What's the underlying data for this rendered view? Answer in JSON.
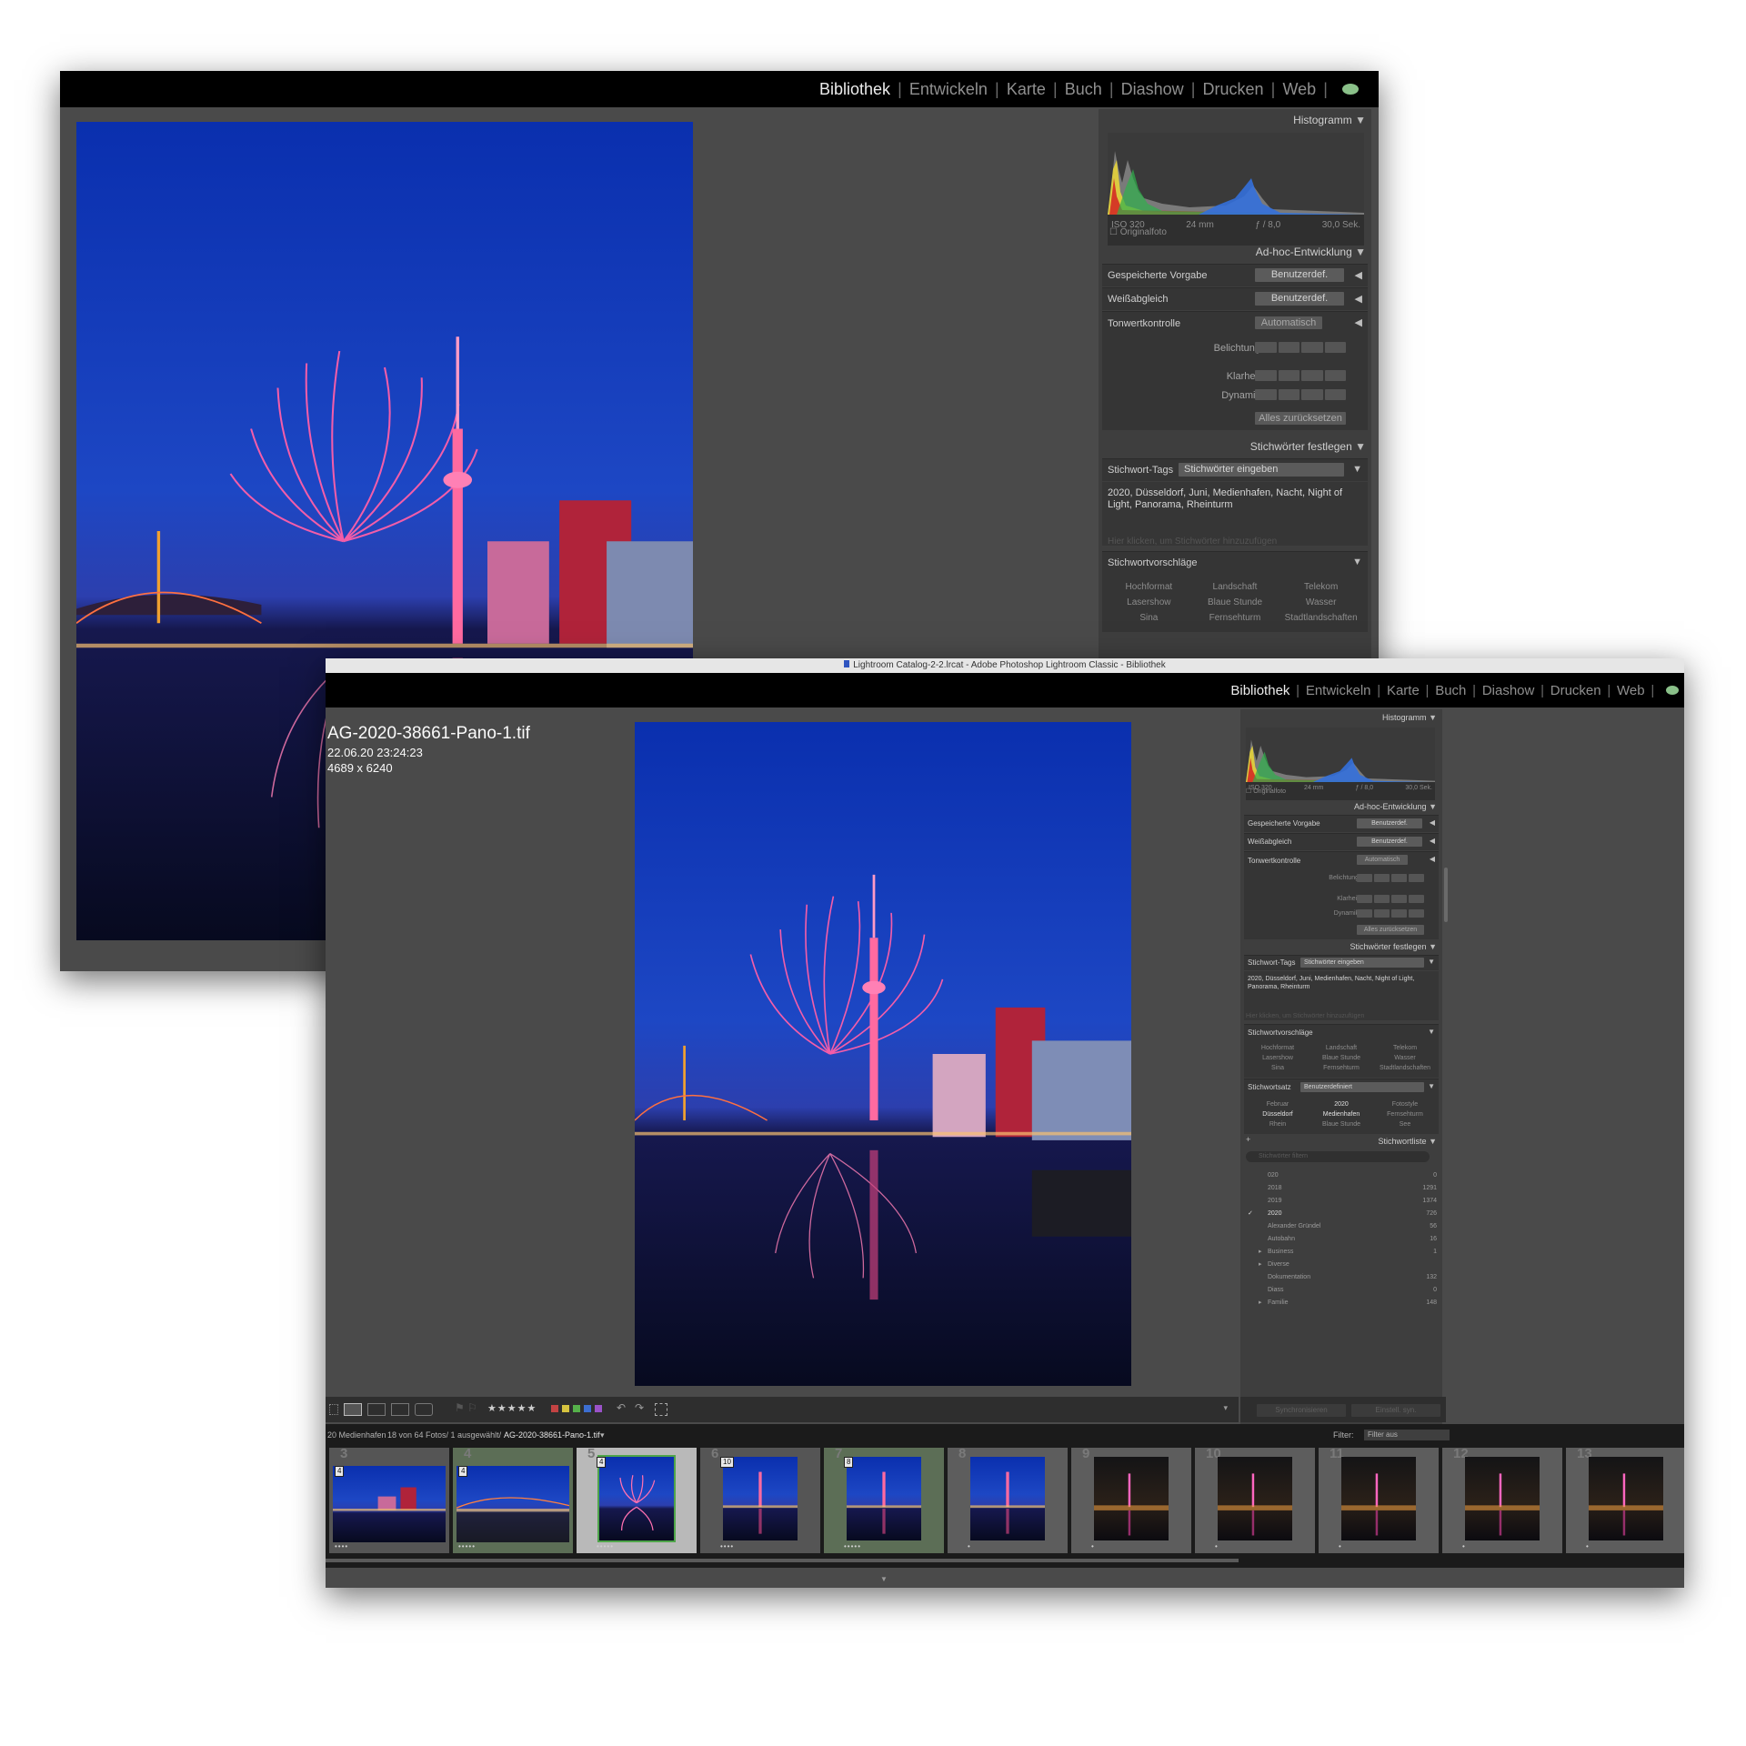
{
  "modules": [
    "Bibliothek",
    "Entwickeln",
    "Karte",
    "Buch",
    "Diashow",
    "Drucken",
    "Web"
  ],
  "active_module": "Bibliothek",
  "title_bar": "Lightroom Catalog-2-2.lrcat - Adobe Photoshop Lightroom Classic - Bibliothek",
  "info_overlay": {
    "filename": "AG-2020-38661-Pano-1.tif",
    "datetime": "22.06.20 23:24:23",
    "dimensions": "4689 x 6240"
  },
  "histogram": {
    "title": "Histogramm",
    "iso": "ISO 320",
    "focal": "24 mm",
    "aperture": "ƒ / 8,0",
    "shutter": "30,0 Sek.",
    "original": "Originalfoto"
  },
  "quick_develop": {
    "title": "Ad-hoc-Entwicklung",
    "saved_preset_label": "Gespeicherte Vorgabe",
    "saved_preset_value": "Benutzerdef.",
    "wb_label": "Weißabgleich",
    "wb_value": "Benutzerdef.",
    "tone_label": "Tonwertkontrolle",
    "tone_button": "Automatisch",
    "exposure_label": "Belichtung",
    "clarity_label": "Klarheit",
    "vibrance_label": "Dynamik",
    "reset_button": "Alles zurücksetzen"
  },
  "keywording": {
    "title": "Stichwörter festlegen",
    "tags_label": "Stichwort-Tags",
    "tags_dropdown": "Stichwörter eingeben",
    "keywords": "2020, Düsseldorf, Juni, Medienhafen, Nacht, Night of Light, Panorama, Rheinturm",
    "click_hint": "Hier klicken, um Stichwörter hinzuzufügen",
    "suggestions_label": "Stichwortvorschläge",
    "suggestions": [
      "Hochformat",
      "Landschaft",
      "Telekom",
      "Lasershow",
      "Blaue Stunde",
      "Wasser",
      "Sina",
      "Fernsehturm",
      "Stadtlandschaften"
    ],
    "set_label": "Stichwortsatz",
    "set_value": "Benutzerdefiniert",
    "set_items": [
      "Februar",
      "2020",
      "Fotostyle",
      "Düsseldorf",
      "Medienhafen",
      "Fernsehturm",
      "Rhein",
      "Blaue Stunde",
      "See"
    ]
  },
  "keyword_list": {
    "title": "Stichwortliste",
    "filter_placeholder": "Stichwörter filtern",
    "items": [
      {
        "name": "020",
        "count": "0"
      },
      {
        "name": "2018",
        "count": "1291"
      },
      {
        "name": "2019",
        "count": "1374"
      },
      {
        "name": "2020",
        "count": "726"
      },
      {
        "name": "Alexander Gründel",
        "count": "56"
      },
      {
        "name": "Autobahn",
        "count": "16"
      },
      {
        "name": "Business",
        "count": "1"
      },
      {
        "name": "Diverse",
        "count": ""
      },
      {
        "name": "Dokumentation",
        "count": "132"
      },
      {
        "name": "Diass",
        "count": "0"
      },
      {
        "name": "Familie",
        "count": "148"
      }
    ]
  },
  "bottom_buttons": {
    "sync": "Synchronisieren",
    "settings": "Einstell. syn."
  },
  "filmstrip": {
    "breadcrumb": "20 Medienhafen",
    "count": "18 von 64 Fotos/ 1 ausgewählt/",
    "current": "AG-2020-38661-Pano-1.tif",
    "filter_label": "Filter:",
    "filter_value": "Filter aus",
    "cells": [
      {
        "num": "3",
        "badge": "4",
        "stars": "••••",
        "style": "blue"
      },
      {
        "num": "4",
        "badge": "4",
        "stars": "•••••",
        "style": "bridge"
      },
      {
        "num": "5",
        "badge": "4",
        "stars": "•••••",
        "style": "fireworks"
      },
      {
        "num": "6",
        "badge": "10",
        "stars": "••••",
        "style": "tower"
      },
      {
        "num": "7",
        "badge": "8",
        "stars": "•••••",
        "style": "tower"
      },
      {
        "num": "8",
        "badge": "",
        "stars": "•",
        "style": "tower"
      },
      {
        "num": "9",
        "badge": "",
        "stars": "•",
        "style": "night"
      },
      {
        "num": "10",
        "badge": "",
        "stars": "•",
        "style": "night"
      },
      {
        "num": "11",
        "badge": "",
        "stars": "•",
        "style": "night"
      },
      {
        "num": "12",
        "badge": "",
        "stars": "•",
        "style": "night"
      },
      {
        "num": "13",
        "badge": "",
        "stars": "•",
        "style": "night"
      }
    ]
  },
  "toolbar": {
    "rating": "★★★★★"
  },
  "colors": {
    "accent": "#8ac089",
    "background": "#4a4a4a",
    "panel": "#3e3e3e",
    "topbar": "#000000"
  },
  "icons": [
    "cloud-sync-icon",
    "grid-view-icon",
    "loupe-view-icon",
    "compare-view-icon",
    "survey-view-icon",
    "people-view-icon",
    "flag-icon",
    "rotate-left-icon",
    "rotate-right-icon",
    "crop-icon"
  ]
}
